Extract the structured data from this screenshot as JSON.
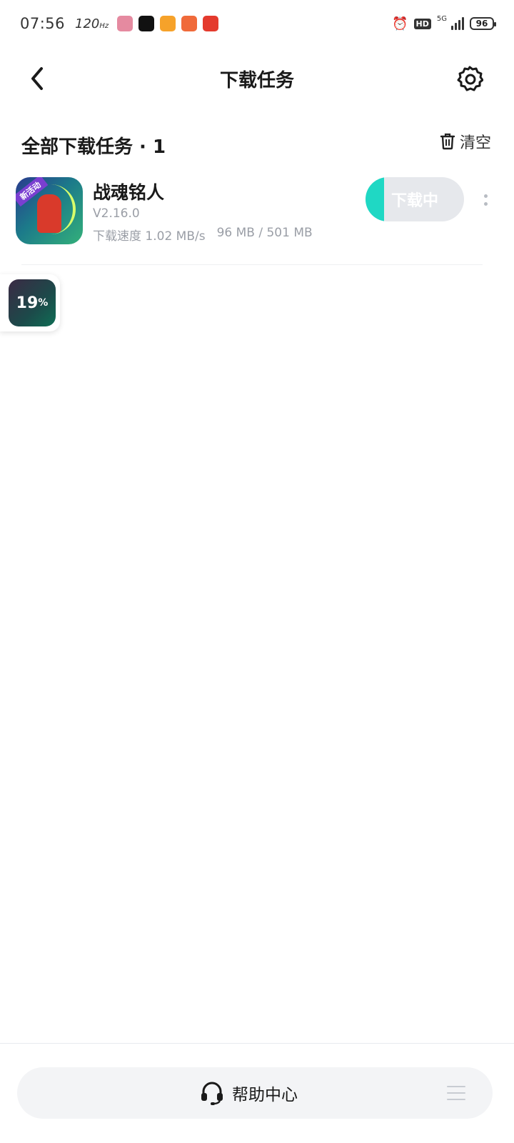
{
  "status_bar": {
    "time": "07:56",
    "refresh_rate": "120",
    "refresh_unit": "Hz",
    "network": "5G",
    "hd": "HD",
    "battery": "96",
    "notification_apps": [
      "app-1",
      "tiktok",
      "app-3",
      "app-4",
      "app-5"
    ],
    "notification_colors": [
      "#e58aa0",
      "#111111",
      "#f6a22a",
      "#f06a3a",
      "#e43a2d"
    ]
  },
  "header": {
    "title": "下载任务"
  },
  "section": {
    "title": "全部下载任务 · 1",
    "clear_label": "清空"
  },
  "tasks": [
    {
      "name": "战魂铭人",
      "tag": "新活动",
      "version": "V2.16.0",
      "speed": "下载速度 1.02 MB/s",
      "size": "96 MB / 501 MB",
      "status_label": "下载中",
      "progress": 0.19
    }
  ],
  "floating_progress": {
    "value": "19",
    "unit": "%"
  },
  "bottom": {
    "help_label": "帮助中心"
  },
  "colors": {
    "accent": "#1fd8c4",
    "button_bg": "#e6e8ec",
    "secondary_text": "#9a9ea6"
  }
}
